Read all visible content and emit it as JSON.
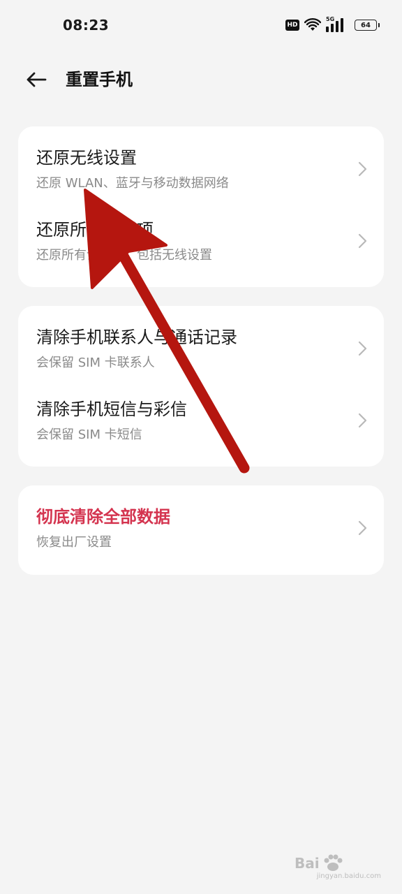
{
  "status_bar": {
    "time": "08:23",
    "hd_label": "HD",
    "network_label": "5G",
    "battery": "64"
  },
  "header": {
    "title": "重置手机"
  },
  "sections": [
    {
      "items": [
        {
          "title": "还原无线设置",
          "subtitle": "还原 WLAN、蓝牙与移动数据网络"
        },
        {
          "title": "还原所有设置项",
          "subtitle": "还原所有设置项，包括无线设置"
        }
      ]
    },
    {
      "items": [
        {
          "title": "清除手机联系人与通话记录",
          "subtitle": "会保留 SIM 卡联系人"
        },
        {
          "title": "清除手机短信与彩信",
          "subtitle": "会保留 SIM 卡短信"
        }
      ]
    },
    {
      "items": [
        {
          "title": "彻底清除全部数据",
          "subtitle": "恢复出厂设置"
        }
      ]
    }
  ],
  "colors": {
    "background": "#f4f4f4",
    "card": "#ffffff",
    "danger_text": "#d4344f",
    "annotation_arrow": "#b5160f"
  },
  "watermark": {
    "text": "Bai",
    "subtext": "jingyan.baidu.com"
  }
}
